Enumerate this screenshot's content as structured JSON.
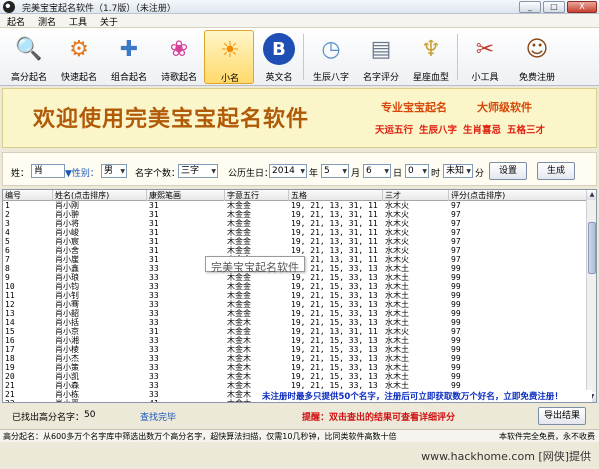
{
  "window": {
    "title": "完美宝宝起名软件（1.7版）（未注册）",
    "buttons": [
      "_",
      "□",
      "X"
    ]
  },
  "menu": [
    "起名",
    "测名",
    "工具",
    "关于"
  ],
  "toolbar": [
    {
      "label": "高分起名",
      "icon": "magnifier-icon"
    },
    {
      "label": "快速起名",
      "icon": "gear-icon"
    },
    {
      "label": "组合起名",
      "icon": "puzzle-icon"
    },
    {
      "label": "诗歌起名",
      "icon": "butterfly-icon"
    },
    {
      "label": "小名",
      "icon": "sun-icon"
    },
    {
      "label": "英文名",
      "icon": "b-letter-icon"
    },
    {
      "label": "生辰八字",
      "icon": "clock-icon"
    },
    {
      "label": "名字评分",
      "icon": "id-card-icon"
    },
    {
      "label": "星座血型",
      "icon": "angel-icon"
    },
    {
      "label": "小工具",
      "icon": "tools-icon"
    },
    {
      "label": "免费注册",
      "icon": "avatar-icon"
    }
  ],
  "banner": {
    "main": "欢迎使用完美宝宝起名软件",
    "sub1": "专业宝宝起名",
    "sub2": "大师级软件",
    "row2": [
      "天运五行",
      "生辰八字",
      "生肖喜忌",
      "五格三才"
    ]
  },
  "form": {
    "surname_label": "姓：",
    "surname_value": "肖",
    "gender_label": "▼性别：",
    "gender_value": "男",
    "name_count_label": "名字个数：",
    "name_count_value": "三字",
    "birthday_label": "公历生日：",
    "year_value": "2014",
    "year_unit": "年",
    "month_value": "5",
    "month_unit": "月",
    "day_value": "6",
    "day_unit": "日",
    "hour_value": "0",
    "hour_unit": "时",
    "minute_value": "未知",
    "minute_unit": "分",
    "settings_label": "设置",
    "generate_label": "生成"
  },
  "table": {
    "columns": [
      "编号",
      "姓名(点击排序)",
      "康熙笔画",
      "字意五行",
      "五格",
      "三才",
      "评分(点击排序)"
    ],
    "rows": [
      [
        "1",
        "肖小刚",
        "31",
        "木金金",
        "19, 21, 13, 31, 11",
        "水木火",
        "97"
      ],
      [
        "2",
        "肖小翀",
        "31",
        "木金金",
        "19, 21, 13, 31, 11",
        "水木火",
        "97"
      ],
      [
        "3",
        "肖小将",
        "31",
        "木金金",
        "19, 21, 13, 31, 11",
        "水木火",
        "97"
      ],
      [
        "4",
        "肖小峻",
        "31",
        "木金金",
        "19, 21, 13, 31, 11",
        "水木火",
        "97"
      ],
      [
        "5",
        "肖小宸",
        "31",
        "木金金",
        "19, 21, 13, 31, 11",
        "水木火",
        "97"
      ],
      [
        "6",
        "肖小舍",
        "31",
        "木金金",
        "19, 21, 13, 31, 11",
        "水木火",
        "97"
      ],
      [
        "7",
        "肖小崖",
        "31",
        "木金金",
        "19, 21, 13, 31, 11",
        "水木火",
        "97"
      ],
      [
        "8",
        "肖小鑫",
        "33",
        "木金金",
        "19, 21, 15, 33, 13",
        "水木土",
        "99"
      ],
      [
        "9",
        "肖小琅",
        "33",
        "木金金",
        "19, 21, 15, 33, 13",
        "水木土",
        "99"
      ],
      [
        "10",
        "肖小钧",
        "33",
        "木金金",
        "19, 21, 15, 33, 13",
        "水木土",
        "99"
      ],
      [
        "11",
        "肖小钊",
        "33",
        "木金金",
        "19, 21, 15, 33, 13",
        "水木土",
        "99"
      ],
      [
        "12",
        "肖小骞",
        "33",
        "木金金",
        "19, 21, 15, 33, 13",
        "水木土",
        "99"
      ],
      [
        "13",
        "肖小韶",
        "33",
        "木金金",
        "19, 21, 15, 33, 13",
        "水木土",
        "99"
      ],
      [
        "14",
        "肖小括",
        "33",
        "木金木",
        "19, 21, 15, 33, 13",
        "水木土",
        "99"
      ],
      [
        "15",
        "肖小京",
        "31",
        "木金金",
        "19, 21, 13, 31, 11",
        "水木火",
        "97"
      ],
      [
        "16",
        "肖小湘",
        "33",
        "木金木",
        "19, 21, 15, 33, 13",
        "水木土",
        "99"
      ],
      [
        "17",
        "肖小棱",
        "33",
        "木金木",
        "19, 21, 15, 33, 13",
        "水木土",
        "99"
      ],
      [
        "18",
        "肖小杰",
        "33",
        "木金木",
        "19, 21, 15, 33, 13",
        "水木土",
        "99"
      ],
      [
        "19",
        "肖小策",
        "33",
        "木金木",
        "19, 21, 15, 33, 13",
        "水木土",
        "99"
      ],
      [
        "20",
        "肖小凯",
        "33",
        "木金木",
        "19, 21, 15, 33, 13",
        "水木土",
        "99"
      ],
      [
        "21",
        "肖小森",
        "33",
        "木金木",
        "19, 21, 15, 33, 13",
        "水木土",
        "99"
      ],
      [
        "21",
        "肖小栋",
        "33",
        "木金木",
        "19, 21, 15, 33, 13",
        "水木土",
        "99"
      ],
      [
        "22",
        "肖小严",
        "41",
        "木金木",
        "19, 21, 15, 33, 13",
        "水木土",
        "99"
      ]
    ]
  },
  "tooltip": "完美宝宝起名软件",
  "register_notice": "未注册时最多只提供50个名字，注册后可立即获取数万个好名，立即免费注册！",
  "bottom": {
    "found_label": "已找出高分名字：",
    "found_count": "50",
    "search_done": "查找完毕",
    "hint": "提醒：双击查出的结果可查看详细评分",
    "export_label": "导出结果"
  },
  "status": {
    "left": "高分起名：从600多万个名字库中筛选出数万个高分名字，超快算法扫描，仅需10几秒钟，比同类软件高数十倍",
    "right": "本软件完全免费，永不收费"
  },
  "watermark": "www.hackhome.com [网侠]提供",
  "colors": {
    "banner_bg": "#fbf6c9",
    "banner_text": "#b05a08",
    "accent_red": "#e02010",
    "notice_blue": "#0b2bbf"
  }
}
